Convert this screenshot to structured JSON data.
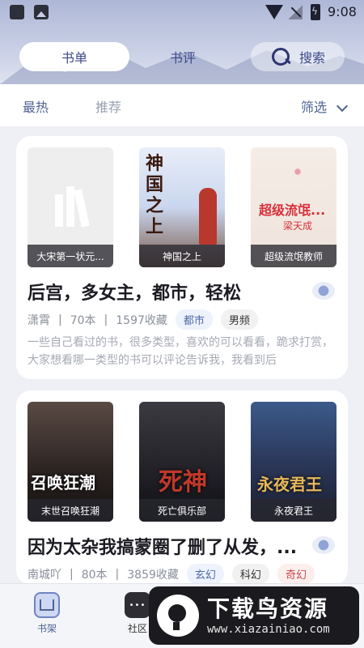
{
  "status_bar": {
    "time": "9:08"
  },
  "header": {
    "tabs": [
      {
        "label": "书单",
        "active": true
      },
      {
        "label": "书评",
        "active": false
      }
    ],
    "search_label": "搜索"
  },
  "filter": {
    "hot": "最热",
    "recommend": "推荐",
    "filter": "筛选"
  },
  "booklists": [
    {
      "covers": [
        {
          "caption": "大宋第一状元..."
        },
        {
          "caption": "神国之上",
          "art": "神国之上"
        },
        {
          "caption": "超级流氓教师",
          "art": "超级流氓...",
          "art2": "梁天成"
        }
      ],
      "title": "后宫，多女主，都市，轻松",
      "author": "潇霄",
      "count": "70本",
      "favorites": "1597收藏",
      "tags": [
        {
          "label": "都市",
          "style": "blue"
        },
        {
          "label": "男频",
          "style": "gray"
        }
      ],
      "description": "一些自己看过的书，很多类型，喜欢的可以看看，跪求打赏，大家想看哪一类型的书可以评论告诉我，我看到后"
    },
    {
      "covers": [
        {
          "caption": "末世召唤狂潮",
          "art": "召唤狂潮"
        },
        {
          "caption": "死亡俱乐部",
          "art": "死神"
        },
        {
          "caption": "永夜君王",
          "art": "永夜君王"
        }
      ],
      "title": "因为太杂我搞蒙圈了删了从发，...",
      "author": "南城吖",
      "count": "80本",
      "favorites": "3859收藏",
      "tags": [
        {
          "label": "玄幻",
          "style": "blue"
        },
        {
          "label": "科幻",
          "style": "gray"
        },
        {
          "label": "奇幻",
          "style": "red"
        }
      ]
    }
  ],
  "bottom_nav": {
    "items": [
      {
        "label": "书架"
      },
      {
        "label": "社区"
      }
    ]
  },
  "watermark": {
    "main": "下载鸟资源",
    "url": "www.xiazainiao.com"
  }
}
